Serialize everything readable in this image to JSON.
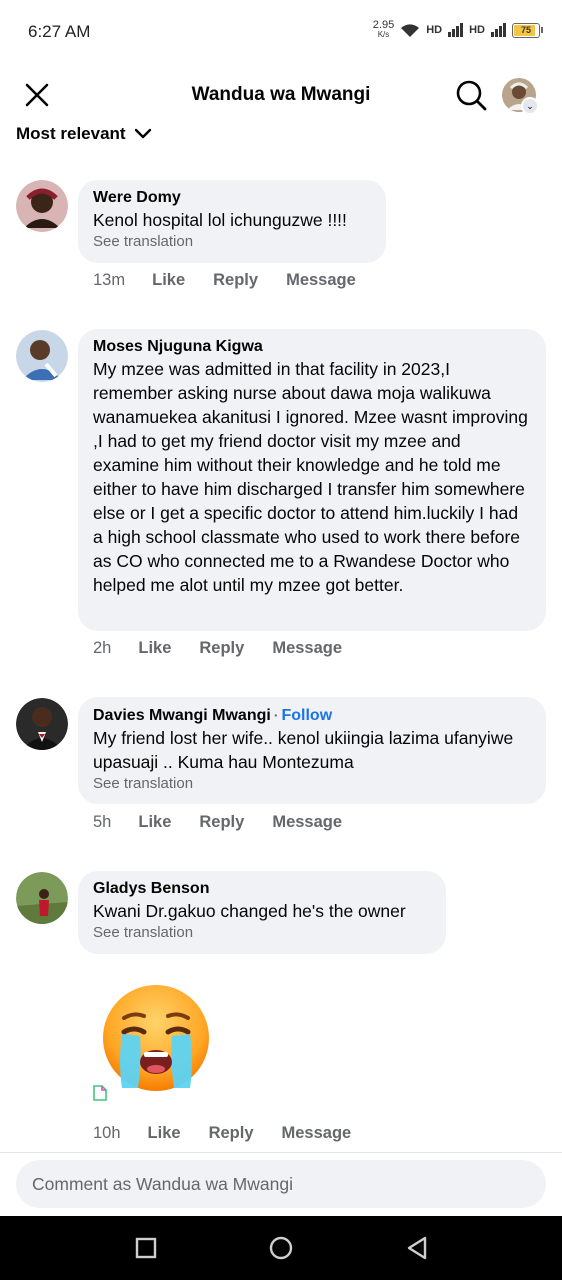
{
  "status": {
    "time": "6:27 AM",
    "speed_value": "2.95",
    "speed_unit": "K/s",
    "hd1": "HD",
    "hd2": "HD",
    "battery": "75"
  },
  "header": {
    "title": "Wandua wa Mwangi"
  },
  "sort": {
    "label": "Most relevant"
  },
  "comments": [
    {
      "author": "Were Domy",
      "text": "Kenol hospital lol ichunguzwe !!!!",
      "see_translation": "See translation",
      "time": "13m",
      "like": "Like",
      "reply": "Reply",
      "message": "Message"
    },
    {
      "author": "Moses Njuguna Kigwa",
      "text": "My mzee was admitted in that facility in 2023,I remember asking nurse about dawa moja walikuwa wanamuekea akanitusi I ignored. Mzee wasnt improving ,I had to get my friend doctor visit my mzee and examine him without their knowledge and he told me either to have him discharged I transfer him somewhere else or I get a specific doctor to attend him.luckily I had a high school classmate who used to work there before as CO who connected me to a Rwandese Doctor who helped me alot until my mzee got better.",
      "time": "2h",
      "like": "Like",
      "reply": "Reply",
      "message": "Message"
    },
    {
      "author": "Davies Mwangi Mwangi",
      "follow_sep": "·",
      "follow": "Follow",
      "text": "My friend lost her wife.. kenol ukiingia lazima ufanyiwe upasuaji .. Kuma hau Montezuma",
      "see_translation": "See translation",
      "time": "5h",
      "like": "Like",
      "reply": "Reply",
      "message": "Message"
    },
    {
      "author": "Gladys Benson",
      "text": "Kwani Dr.gakuo changed he's the owner",
      "see_translation": "See translation",
      "time": "10h",
      "like": "Like",
      "reply": "Reply",
      "message": "Message",
      "sticker": "loudly-crying-face-emoji"
    }
  ],
  "composer": {
    "placeholder": "Comment as Wandua wa Mwangi"
  },
  "colors": {
    "bubble": "#f0f2f5",
    "secondary_text": "#65676b",
    "link": "#1b74e4"
  }
}
